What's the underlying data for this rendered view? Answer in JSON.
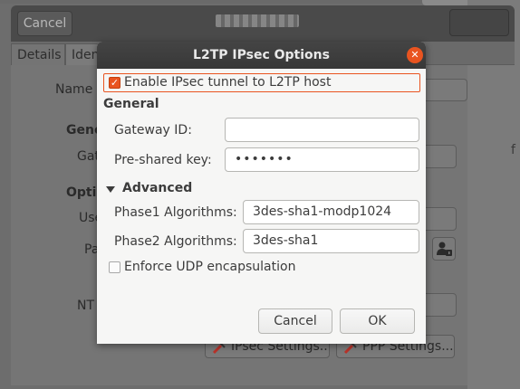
{
  "background_window": {
    "cancel_label": "Cancel",
    "tabs": [
      "Details",
      "Iden"
    ],
    "labels": {
      "name": "Name",
      "general": "Gene",
      "gateway": "Gat",
      "options": "Optio",
      "user": "Use",
      "password": "Pa",
      "nt": "NT",
      "edge": "f"
    },
    "ipsec_settings_label": "IPsec Settings...",
    "ppp_settings_label": "PPP Settings..."
  },
  "dialog": {
    "title": "L2TP IPsec Options",
    "enable_tunnel": {
      "label": "Enable IPsec tunnel to L2TP host",
      "checked": true
    },
    "general_heading": "General",
    "gateway_id": {
      "label": "Gateway ID:",
      "value": ""
    },
    "preshared_key": {
      "label": "Pre-shared key:",
      "value": "•••••••"
    },
    "advanced_heading": "Advanced",
    "phase1": {
      "label": "Phase1 Algorithms:",
      "value": "3des-sha1-modp1024"
    },
    "phase2": {
      "label": "Phase2 Algorithms:",
      "value": "3des-sha1"
    },
    "enforce_udp": {
      "label": "Enforce UDP encapsulation",
      "checked": false
    },
    "cancel_label": "Cancel",
    "ok_label": "OK"
  },
  "colors": {
    "accent": "#e95420",
    "titlebar": "#3c3c3c",
    "dialog_bg": "#f6f6f5",
    "dimmed_bg": "#757575"
  }
}
